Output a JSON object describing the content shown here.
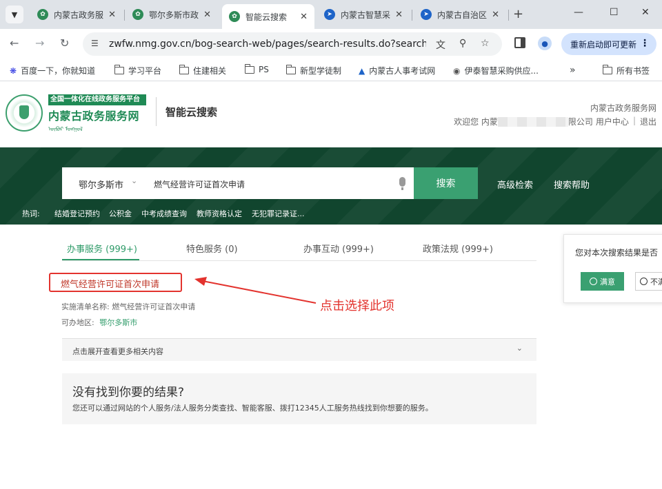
{
  "browser": {
    "tabs": [
      {
        "title": "内蒙古政务服",
        "favicon": "green",
        "active": false
      },
      {
        "title": "鄂尔多斯市政",
        "favicon": "green",
        "active": false
      },
      {
        "title": "智能云搜索",
        "favicon": "green",
        "active": true
      },
      {
        "title": "内蒙古智慧采",
        "favicon": "blue",
        "active": false
      },
      {
        "title": "内蒙古自治区",
        "favicon": "blue",
        "active": false
      }
    ],
    "url": "zwfw.nmg.gov.cn/bog-search-web/pages/search-results.do?search...",
    "update_button": "重新启动即可更新",
    "bookmarks": [
      "百度一下，你就知道",
      "学习平台",
      "住建相关",
      "PS",
      "新型学徒制",
      "内蒙古人事考试网",
      "伊泰智慧采购供应..."
    ],
    "all_bookmarks": "所有书签"
  },
  "site": {
    "banner": "全国一体化在线政务服务平台",
    "name": "内蒙古政务服务网",
    "page_title": "智能云搜索",
    "site_name_right": "内蒙古政务服务网",
    "welcome_prefix": "欢迎您 内蒙",
    "welcome_suffix": "限公司",
    "user_center": "用户中心",
    "logout": "退出"
  },
  "search": {
    "region": "鄂尔多斯市",
    "query": "燃气经营许可证首次申请",
    "button": "搜索",
    "advanced": "高级检索",
    "help": "搜索帮助",
    "hot_label": "热词:",
    "hot_words": [
      "结婚登记预约",
      "公积金",
      "中考成绩查询",
      "教师资格认定",
      "无犯罪记录证..."
    ]
  },
  "results": {
    "tabs": [
      {
        "label": "办事服务 (999+)",
        "active": true
      },
      {
        "label": "特色服务 (0)",
        "active": false
      },
      {
        "label": "办事互动 (999+)",
        "active": false
      },
      {
        "label": "政策法规 (999+)",
        "active": false
      }
    ],
    "first": {
      "title": "燃气经营许可证首次申请",
      "list_label": "实施清单名称:",
      "list_value": "燃气经营许可证首次申请",
      "area_label": "可办地区:",
      "area_value": "鄂尔多斯市"
    },
    "expand_text": "点击展开查看更多相关内容",
    "annotation": "点击选择此项",
    "no_result_title": "没有找到你要的结果?",
    "no_result_desc": "您还可以通过网站的个人服务/法人服务分类查找、智能客服、拨打12345人工服务热线找到你想要的服务。"
  },
  "feedback": {
    "question": "您对本次搜索结果是否",
    "satisfied": "满意",
    "unsatisfied": "不满"
  },
  "colors": {
    "brand_green": "#1f8a55",
    "band_dark_green": "#11452e",
    "button_green": "#3aa071",
    "annotation_red": "#e3332e"
  }
}
